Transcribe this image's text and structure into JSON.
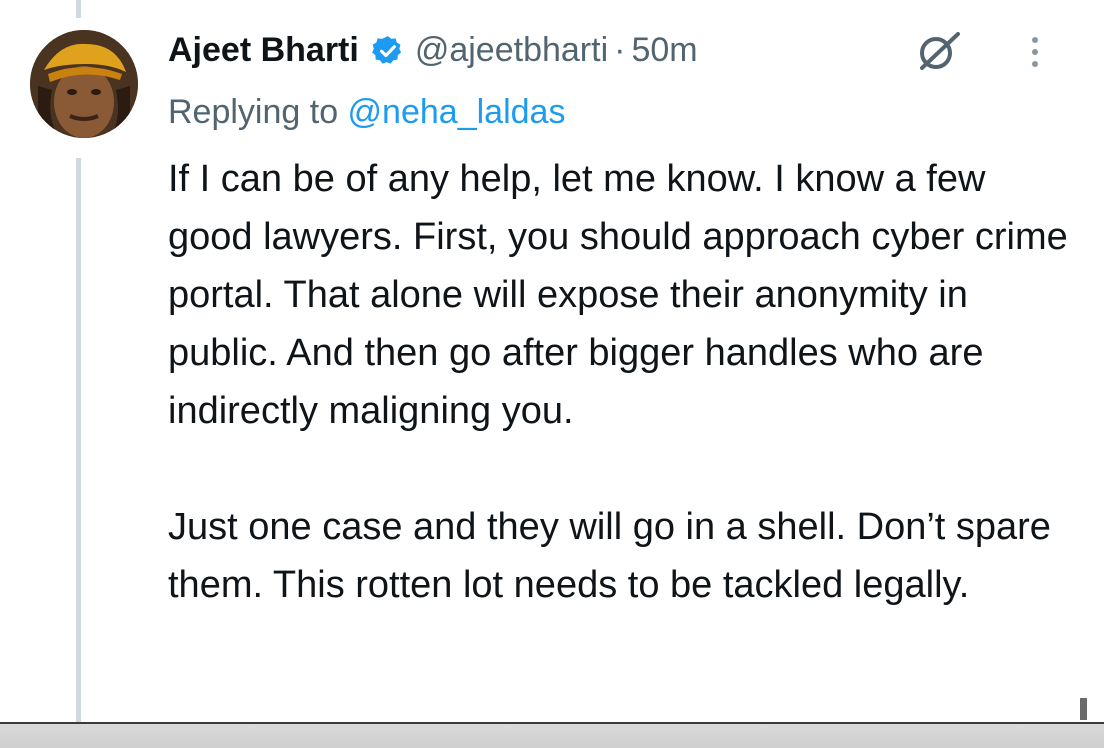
{
  "tweet": {
    "author_name": "Ajeet Bharti",
    "verified_icon": "verified-badge-icon",
    "handle": "@ajeetbharti",
    "separator": "·",
    "time": "50m",
    "grok_icon": "grok-icon",
    "more_icon": "more-options-icon",
    "reply_prefix": "Replying to ",
    "reply_to": "@neha_laldas",
    "paragraphs": [
      "If I can be of any help, let me know. I know a few good lawyers. First, you should approach cyber crime portal. That alone will expose their anonymity in public. And then go after bigger handles who are indirectly maligning you.",
      "Just one case and they will go in a shell. Don’t spare them. This rotten lot needs to be tackled legally."
    ]
  },
  "colors": {
    "text_primary": "#0f1419",
    "text_secondary": "#536471",
    "accent_blue": "#1d9bf0",
    "thread_line": "#cfd9de"
  }
}
